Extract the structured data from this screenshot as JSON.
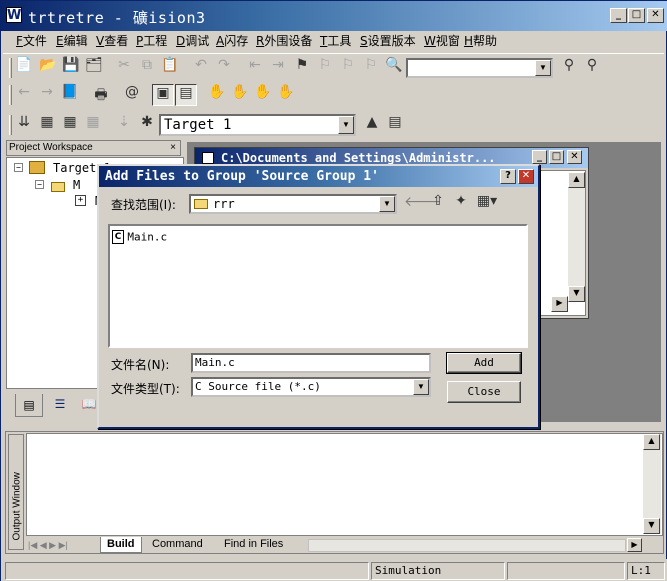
{
  "app": {
    "icon": "W",
    "title": "trtretre  - 礦ision3"
  },
  "window_controls": {
    "minimize": "_",
    "maximize": "□",
    "close": "✕"
  },
  "menu": [
    {
      "key": "F",
      "label": "文件"
    },
    {
      "key": "E",
      "label": "编辑"
    },
    {
      "key": "V",
      "label": "查看"
    },
    {
      "key": "P",
      "label": "工程"
    },
    {
      "key": "D",
      "label": "调试"
    },
    {
      "key": "A",
      "label": "闪存"
    },
    {
      "key": "R",
      "label": "外围设备"
    },
    {
      "key": "T",
      "label": "工具"
    },
    {
      "key": "S",
      "label": "设置版本"
    },
    {
      "key": "W",
      "label": "视窗"
    },
    {
      "key": "H",
      "label": "帮助"
    }
  ],
  "toolbar": {
    "target_select": "Target 1",
    "find_combo": ""
  },
  "icons": {
    "new": "new-file-icon",
    "open": "open-folder-icon",
    "save": "save-icon",
    "save_all": "save-all-icon",
    "cut": "cut-icon",
    "copy": "copy-icon",
    "paste": "paste-icon",
    "undo": "undo-icon",
    "redo": "redo-icon",
    "find": "binoculars-icon",
    "debug": "debug-icon",
    "build": "build-icon",
    "load": "load-icon"
  },
  "workspace": {
    "title": "Project Workspace",
    "close": "×",
    "tree": [
      {
        "text": "Target 1",
        "expander": "−"
      },
      {
        "text": "Sour",
        "expander": "−"
      },
      {
        "text": "M",
        "expander": "+"
      }
    ]
  },
  "editor": {
    "title": "C:\\Documents and Settings\\Administr..."
  },
  "dialog": {
    "title": "Add Files to Group 'Source Group 1'",
    "help": "?",
    "close": "✕",
    "look_in_label": "查找范围(I):",
    "look_in_value": "rrr",
    "files": [
      {
        "icon": "C",
        "name": "Main.c"
      }
    ],
    "filename_label": "文件名(N):",
    "filename_value": "Main.c",
    "filetype_label": "文件类型(T):",
    "filetype_value": "C Source file (*.c)",
    "add_button": "Add",
    "close_button": "Close"
  },
  "output": {
    "side_tab": "Output Window",
    "tabs": [
      "Build",
      "Command",
      "Find in Files"
    ]
  },
  "status": {
    "mode": "Simulation",
    "line": "L:1"
  }
}
